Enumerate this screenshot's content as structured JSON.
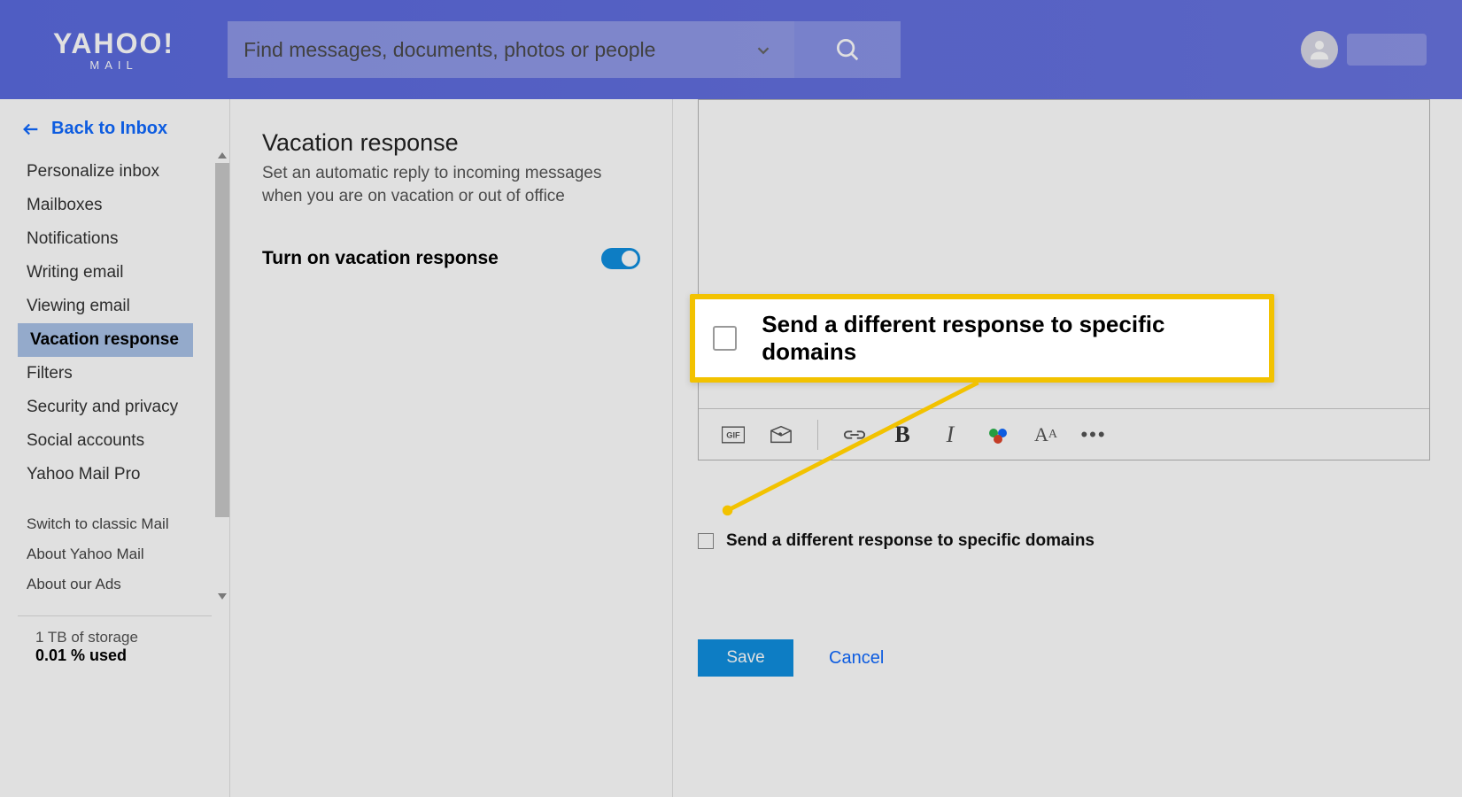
{
  "header": {
    "logo_main": "YAHOO",
    "logo_bang": "!",
    "logo_sub": "MAIL",
    "search_placeholder": "Find messages, documents, photos or people"
  },
  "sidebar": {
    "back_label": "Back to Inbox",
    "items": [
      "Personalize inbox",
      "Mailboxes",
      "Notifications",
      "Writing email",
      "Viewing email",
      "Vacation response",
      "Filters",
      "Security and privacy",
      "Social accounts",
      "Yahoo Mail Pro"
    ],
    "active_index": 5,
    "sub_items": [
      "Switch to classic Mail",
      "About Yahoo Mail",
      "About our Ads"
    ],
    "storage_total": "1 TB of storage",
    "storage_used": "0.01 % used"
  },
  "settings": {
    "title": "Vacation response",
    "description": "Set an automatic reply to incoming messages when you are on vacation or out of office",
    "toggle_label": "Turn on vacation response"
  },
  "right": {
    "checkbox_label": "Send a different response to specific domains",
    "save_label": "Save",
    "cancel_label": "Cancel"
  },
  "callout": {
    "label": "Send a different response to specific domains"
  }
}
